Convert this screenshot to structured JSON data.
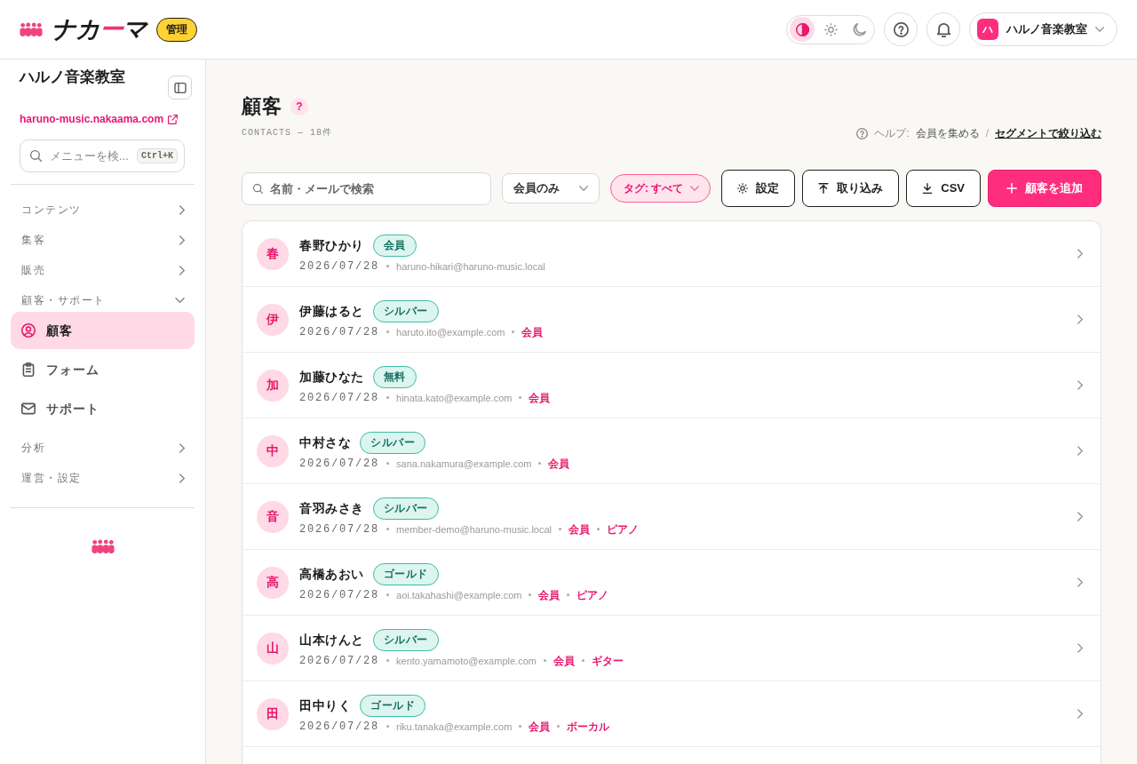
{
  "header": {
    "logo": {
      "parts": [
        {
          "text": "ナカ",
          "accent": false
        },
        {
          "text": "ー",
          "accent": true
        },
        {
          "text": "マ",
          "accent": false
        }
      ]
    },
    "role_badge": "管理",
    "theme_switch": [
      {
        "kind": "system",
        "selected": true
      },
      {
        "kind": "light",
        "selected": false
      },
      {
        "kind": "dark",
        "selected": false
      }
    ],
    "account": {
      "initial": "ハ",
      "name": "ハルノ音楽教室"
    }
  },
  "sidebar": {
    "title": "ハルノ音楽教室",
    "site_link": "haruno-music.nakaama.com",
    "search": {
      "placeholder": "メニューを検...",
      "shortcut": "Ctrl+K"
    },
    "items": [
      {
        "label": "コンテンツ",
        "expanded": false
      },
      {
        "label": "集客",
        "expanded": false
      },
      {
        "label": "販売",
        "expanded": false
      },
      {
        "label": "顧客・サポート",
        "expanded": true,
        "children": [
          {
            "label": "顧客",
            "selected": true
          },
          {
            "label": "フォーム",
            "selected": false
          },
          {
            "label": "サポート",
            "selected": false
          }
        ]
      },
      {
        "label": "分析",
        "expanded": false
      },
      {
        "label": "運営・設定",
        "expanded": false
      }
    ]
  },
  "main": {
    "title": "顧客",
    "title_help": "?",
    "subtitle": "CONTACTS — 18件",
    "help": {
      "label": "ヘルプ:",
      "link": "会員を集める",
      "separator": "/",
      "segment_link": "セグメントで絞り込む"
    },
    "toolbar": {
      "search_placeholder": "名前・メールで検索",
      "member_filter": "会員のみ",
      "tag_filter": "タグ: すべて",
      "buttons": [
        {
          "kind": "settings",
          "label": "設定"
        },
        {
          "kind": "import",
          "label": "取り込み"
        },
        {
          "kind": "export",
          "label": "CSV"
        },
        {
          "kind": "add",
          "label": "顧客を追加"
        }
      ]
    },
    "contacts": [
      {
        "initial": "春",
        "name": "春野ひかり",
        "plan": "会員",
        "date": "2026/07/28",
        "email": "haruno-hikari@haruno-music.local"
      },
      {
        "initial": "伊",
        "name": "伊藤はると",
        "plan": "シルバー",
        "date": "2026/07/28",
        "email": "haruto.ito@example.com",
        "tags": [
          "会員"
        ]
      },
      {
        "initial": "加",
        "name": "加藤ひなた",
        "plan": "無料",
        "date": "2026/07/28",
        "email": "hinata.kato@example.com",
        "tags": [
          "会員"
        ]
      },
      {
        "initial": "中",
        "name": "中村さな",
        "plan": "シルバー",
        "date": "2026/07/28",
        "email": "sana.nakamura@example.com",
        "tags": [
          "会員"
        ]
      },
      {
        "initial": "音",
        "name": "音羽みさき",
        "plan": "シルバー",
        "date": "2026/07/28",
        "email": "member-demo@haruno-music.local",
        "tags": [
          "会員",
          "ピアノ"
        ]
      },
      {
        "initial": "高",
        "name": "高橋あおい",
        "plan": "ゴールド",
        "date": "2026/07/28",
        "email": "aoi.takahashi@example.com",
        "tags": [
          "会員",
          "ピアノ"
        ]
      },
      {
        "initial": "山",
        "name": "山本けんと",
        "plan": "シルバー",
        "date": "2026/07/28",
        "email": "kento.yamamoto@example.com",
        "tags": [
          "会員",
          "ギター"
        ]
      },
      {
        "initial": "田",
        "name": "田中りく",
        "plan": "ゴールド",
        "date": "2026/07/28",
        "email": "riku.tanaka@example.com",
        "tags": [
          "会員",
          "ボーカル"
        ]
      }
    ]
  }
}
